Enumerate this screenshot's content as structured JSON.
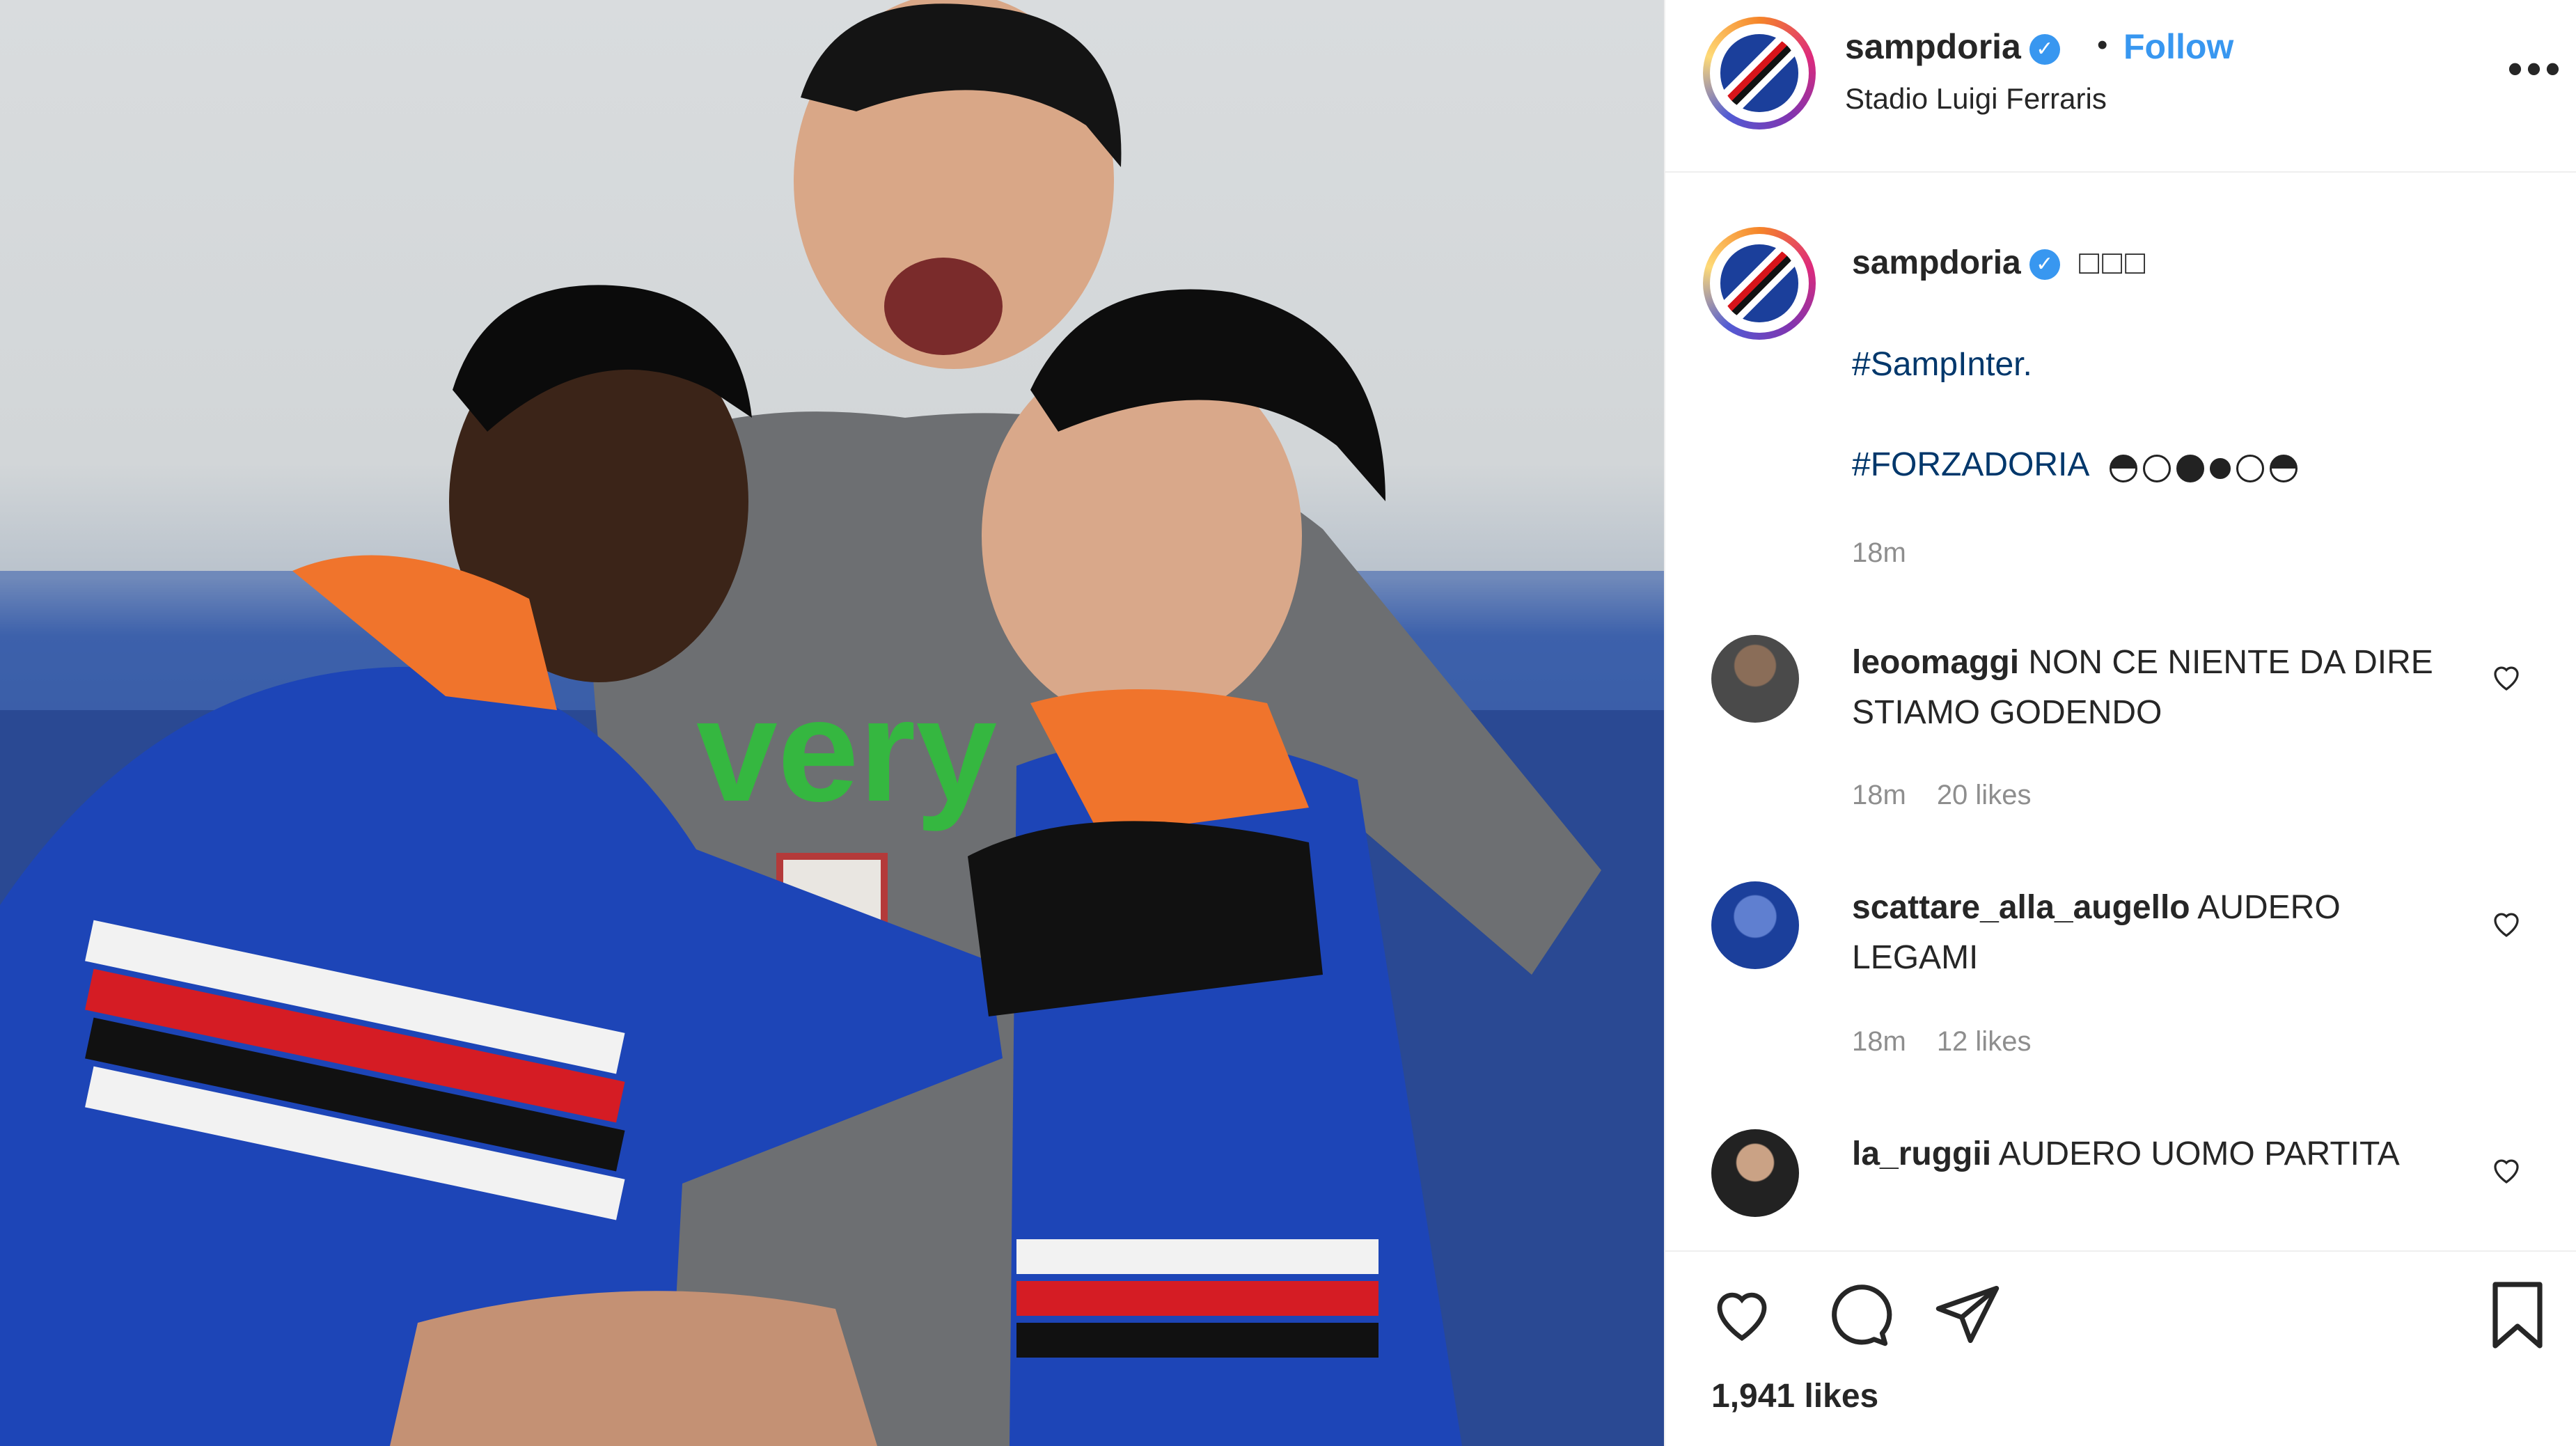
{
  "post": {
    "account": "sampdoria",
    "verified_mark": "✓",
    "follow_separator": "•",
    "follow_label": "Follow",
    "location": "Stadio Luigi Ferraris",
    "more_label": "•••",
    "caption": {
      "username": "sampdoria",
      "emoji_text": "□□□",
      "hashtag_1": "#SampInter.",
      "hashtag_2": "#FORZADORIA",
      "time": "18m"
    },
    "comments": [
      {
        "username": "leoomaggi",
        "text": "NON CE NIENTE DA DIRE STIAMO GODENDO",
        "time": "18m",
        "likes": "20 likes"
      },
      {
        "username": "scattare_alla_augello",
        "text": "AUDERO LEGAMI",
        "time": "18m",
        "likes": "12 likes"
      },
      {
        "username": "la_ruggii",
        "text": "AUDERO UOMO PARTITA"
      }
    ],
    "likes_count": "1,941 likes"
  },
  "icons": {
    "like": "heart-icon",
    "comment": "comment-icon",
    "share": "paper-plane-icon",
    "save": "bookmark-icon",
    "comment_like": "small-heart-icon"
  },
  "colors": {
    "link_blue": "#3897f0",
    "hashtag_blue": "#00376b",
    "muted_gray": "#8e8e8e",
    "sampdoria_blue": "#1b3f9b"
  }
}
